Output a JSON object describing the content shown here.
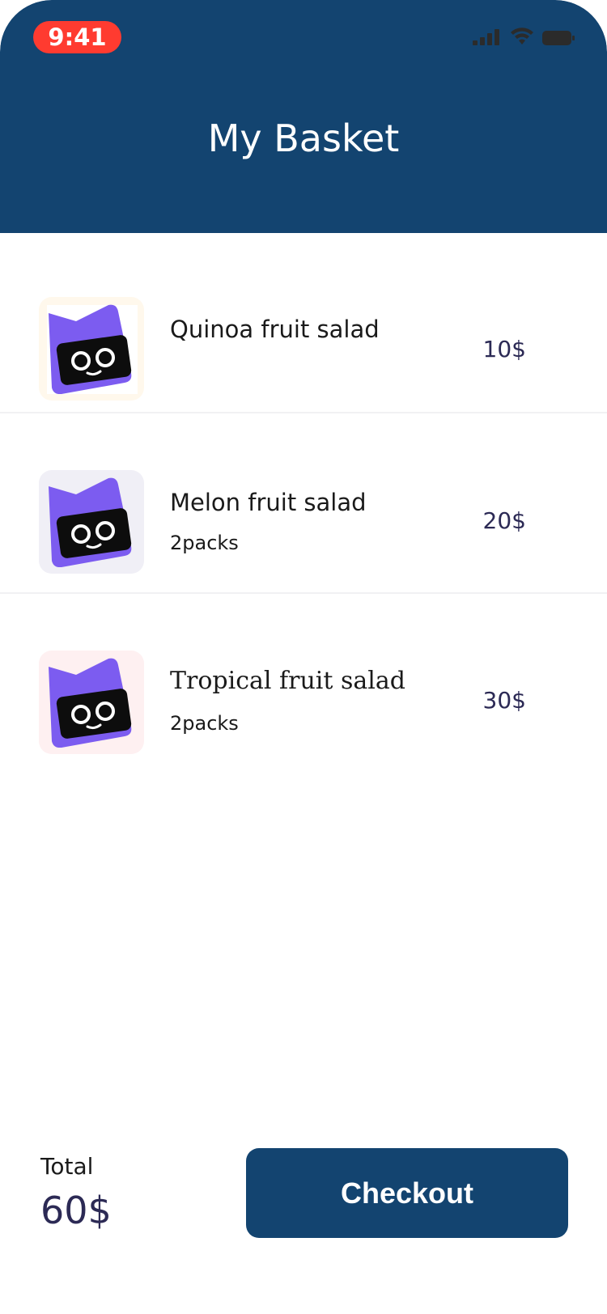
{
  "status_bar": {
    "time": "9:41"
  },
  "header": {
    "title": "My Basket",
    "background": "#134470"
  },
  "items": [
    {
      "name": "Quinoa fruit salad",
      "subtitle": "",
      "price": "10$",
      "thumb_bg": "#fff8ec",
      "icon": "mascot-icon"
    },
    {
      "name": "Melon fruit salad",
      "subtitle": "2packs",
      "price": "20$",
      "thumb_bg": "#f0eff6",
      "icon": "mascot-icon"
    },
    {
      "name": "Tropical fruit salad",
      "subtitle": "2packs",
      "price": "30$",
      "thumb_bg": "#fef0f1",
      "icon": "mascot-icon"
    }
  ],
  "footer": {
    "total_label": "Total",
    "total_value": "60$",
    "checkout_label": "Checkout"
  },
  "colors": {
    "accent": "#134470",
    "status_time_bg": "#ff3b30",
    "price_text": "#2c2a55",
    "mascot_purple": "#7c5cf0"
  }
}
